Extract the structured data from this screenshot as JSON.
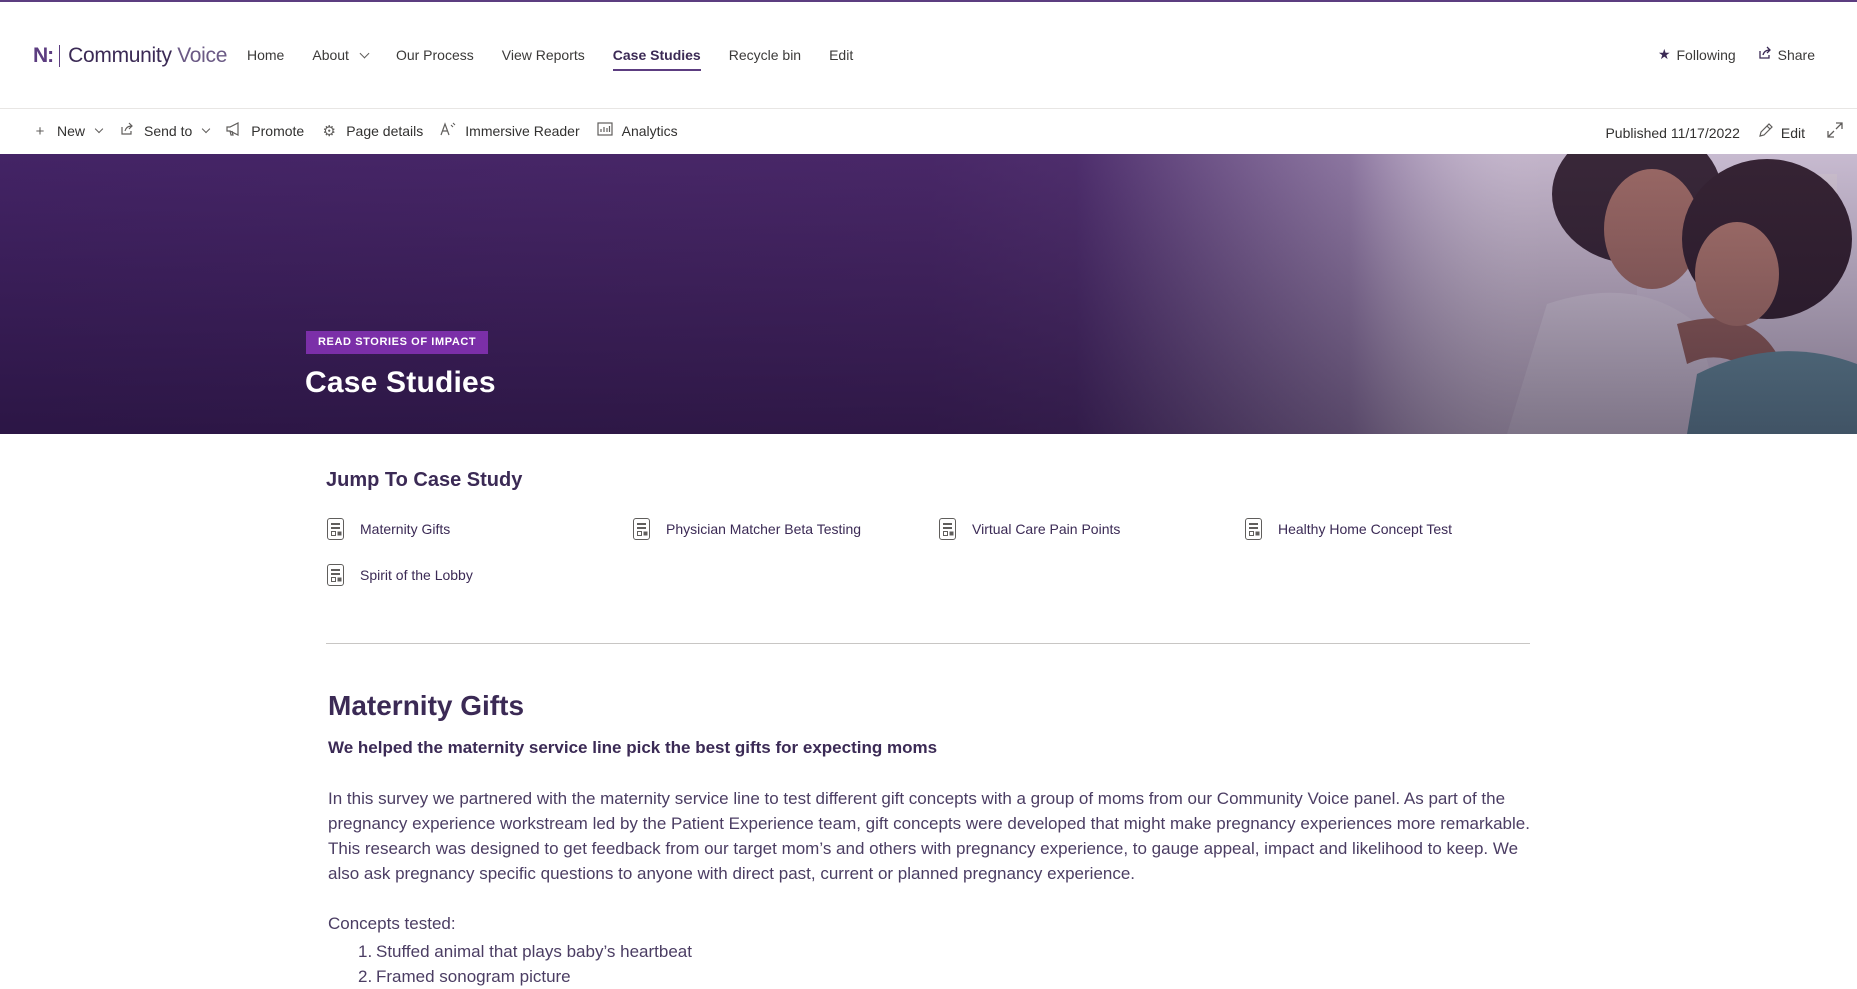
{
  "site": {
    "logo_mark": "N:",
    "logo_text_bold": "Community",
    "logo_text_light": "Voice"
  },
  "nav": {
    "items": [
      {
        "label": "Home"
      },
      {
        "label": "About"
      },
      {
        "label": "Our Process"
      },
      {
        "label": "View Reports"
      },
      {
        "label": "Case Studies"
      },
      {
        "label": "Recycle bin"
      },
      {
        "label": "Edit"
      }
    ],
    "active": "Case Studies"
  },
  "header_actions": {
    "following": "Following",
    "share": "Share"
  },
  "commandbar": {
    "new": "New",
    "send_to": "Send to",
    "promote": "Promote",
    "page_details": "Page details",
    "immersive_reader": "Immersive Reader",
    "analytics": "Analytics",
    "published": "Published 11/17/2022",
    "edit": "Edit"
  },
  "hero": {
    "tag": "READ STORIES OF IMPACT",
    "title": "Case Studies"
  },
  "jump": {
    "title": "Jump To Case Study",
    "items": [
      {
        "label": "Maternity Gifts"
      },
      {
        "label": "Physician Matcher Beta Testing"
      },
      {
        "label": "Virtual Care Pain Points"
      },
      {
        "label": "Healthy Home Concept Test"
      },
      {
        "label": "Spirit of the Lobby"
      }
    ]
  },
  "section": {
    "title": "Maternity Gifts",
    "subtitle": "We helped the maternity service line pick the best gifts for expecting moms",
    "body": "In this survey we partnered with the maternity service line to test different gift concepts with a group of moms from our Community Voice panel. As part of the pregnancy experience workstream led by the Patient Experience team, gift concepts were developed that might make pregnancy experiences more remarkable. This research was designed to get feedback from our target mom’s and others with pregnancy experience, to gauge appeal, impact and likelihood to keep. We also ask pregnancy specific questions to anyone with direct past, current or planned pregnancy experience.",
    "concepts_label": "Concepts tested:",
    "concepts": [
      {
        "num": "1.",
        "text": "Stuffed animal that plays baby’s heartbeat"
      },
      {
        "num": "2.",
        "text": "Framed sonogram picture"
      }
    ]
  },
  "colors": {
    "brand": "#5c3d80",
    "tag": "#7b2fa8",
    "hero_dark": "#3c1f5c",
    "text_purple": "#3b2a55"
  },
  "icons": {
    "following": "star-icon",
    "share": "share-icon",
    "new": "plus-icon",
    "send_to": "send-icon",
    "promote": "megaphone-icon",
    "page_details": "gear-icon",
    "immersive_reader": "reader-icon",
    "analytics": "analytics-icon",
    "edit": "pencil-icon",
    "expand": "expand-icon",
    "jump_item": "document-icon"
  }
}
